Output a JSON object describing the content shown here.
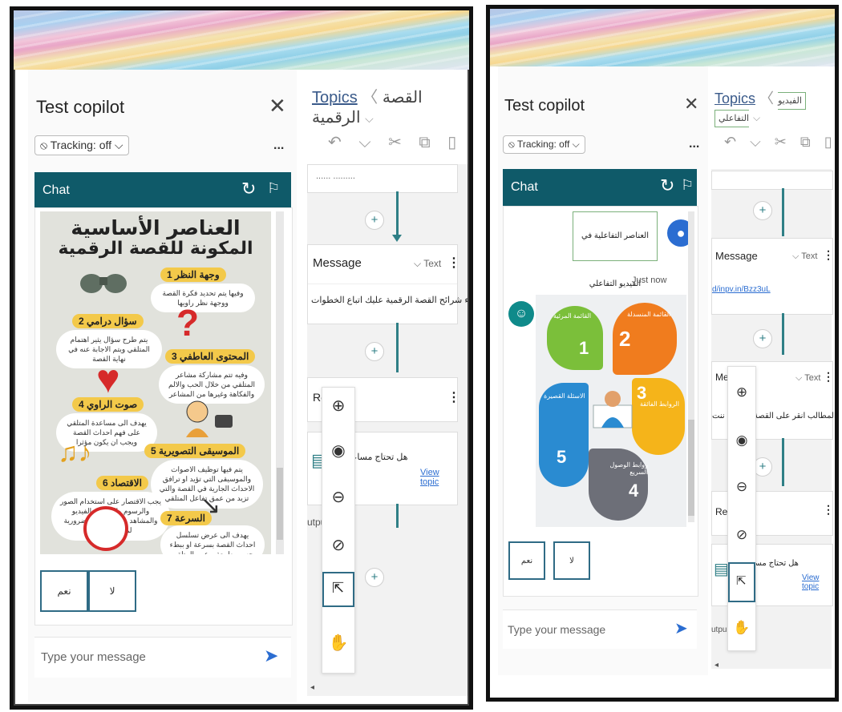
{
  "left": {
    "panel_title": "Test copilot",
    "tracking_label": "⦸ Tracking: off ⌵",
    "more_label": "...",
    "chat_label": "Chat",
    "infographic": {
      "title_line1": "العناصر الأساسية",
      "title_line2": "المكونة للقصة الرقمية",
      "items": [
        {
          "num": "1",
          "label": "وجهة النظر",
          "text": "وفيها يتم تحديد فكرة القصة ووجهة نظر راويها"
        },
        {
          "num": "2",
          "label": "سؤال درامي",
          "text": "يتم طرح سؤال يثير اهتمام المتلقي ويتم الاجابة عنه في نهاية القصة"
        },
        {
          "num": "3",
          "label": "المحتوى العاطفي",
          "text": "وفيه تتم مشاركة مشاعر المتلقي من خلال الحب والالم والفكاهة وغيرها من المشاعر"
        },
        {
          "num": "4",
          "label": "صوت الراوي",
          "text": "يهدف الى مساعدة المتلقي على فهم احداث القصة ويجب ان يكون مؤثرا"
        },
        {
          "num": "5",
          "label": "الموسيقى التصويرية",
          "text": "يتم فيها توظيف الاصوات والموسيقى التي تؤيد او ترافق الاحداث الجارية في القصة والتي تزيد من عمق تفاعل المتلقي"
        },
        {
          "num": "6",
          "label": "الاقتصاد",
          "text": "يجب الاقتصار على استخدام الصور والرسوم والصوت والفيديو والمشاهد والمعلومات الضرورية لمحتوى القصة"
        },
        {
          "num": "7",
          "label": "السرعة",
          "text": "يهدف الى عرض تسلسل احداث القصة بسرعة او ببطء حسب طبيعة و عمر المتلقي"
        }
      ]
    },
    "btn_no": "لا",
    "btn_yes": "نعم",
    "input_placeholder": "Type your message",
    "topics_link": "Topics",
    "topic_name": "القصة الرقمية",
    "node_partial_text": "...... .........",
    "node1_label": "Message",
    "node1_type": "⌵ Text",
    "node1_text": "...لإنشاء شرائح القصة الرقمية عليك اتباع الخطوات",
    "node2_label": "Re",
    "node3_question": "هل تحتاج مساعدة اخ",
    "view_topic": "View topic",
    "output_label": "utpu"
  },
  "right": {
    "panel_title": "Test copilot",
    "tracking_label": "⦸ Tracking: off ⌵",
    "more_label": "...",
    "chat_label": "Chat",
    "user_message": "العناصر التفاعلية في الفيديو التفاعلي",
    "timestamp": "Just now",
    "btn_no": "لا",
    "btn_yes": "نعم",
    "input_placeholder": "Type your message",
    "topics_link": "Topics",
    "topic_name": "الفيديو التفاعلي",
    "node1_label": "Message",
    "node1_type": "⌵ Text",
    "node1_link": "d/inpv.in/Bzz3uL",
    "node2_label": "Me",
    "node2_type": "⌵ Text",
    "node2_text": "...زيارة المطالب انقر على القصة",
    "node2_side": "ية ننت",
    "node3_label": "Re",
    "node3_question": "هل تحتاج مساعدة اخ",
    "view_topic": "View topic",
    "output_label": "utpu",
    "infographic": {
      "items": [
        {
          "num": "1",
          "label": "القائمة المرئية"
        },
        {
          "num": "2",
          "label": "القائمة المنسدلة"
        },
        {
          "num": "3",
          "label": "الروابط الفائقة"
        },
        {
          "num": "4",
          "label": "روابط الوصول السريع"
        },
        {
          "num": "5",
          "label": "الاسئلة القصيرة"
        }
      ]
    }
  },
  "colors": {
    "teal_header": "#0f5a69",
    "accent_blue": "#2b6dd1",
    "flow_line": "#2f7f86"
  }
}
